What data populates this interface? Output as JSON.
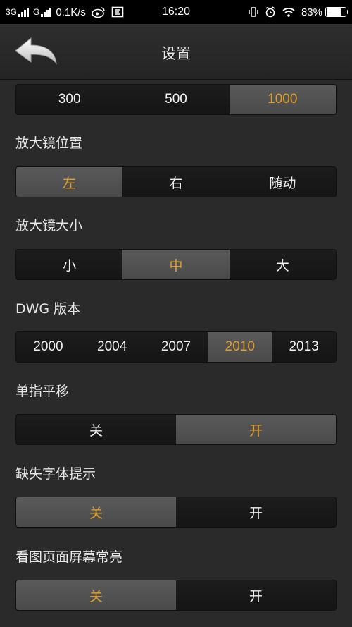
{
  "status_bar": {
    "network1": "3G",
    "network2": "G",
    "speed": "0.1K/s",
    "time": "16:20",
    "battery": "83%",
    "battery_level": 0.83
  },
  "header": {
    "title": "设置"
  },
  "settings": {
    "first_row": {
      "options": [
        "300",
        "500",
        "1000"
      ],
      "selected": 2
    },
    "magnifier_position": {
      "label": "放大镜位置",
      "options": [
        "左",
        "右",
        "随动"
      ],
      "selected": 0
    },
    "magnifier_size": {
      "label": "放大镜大小",
      "options": [
        "小",
        "中",
        "大"
      ],
      "selected": 1
    },
    "dwg_version": {
      "label": "DWG 版本",
      "options": [
        "2000",
        "2004",
        "2007",
        "2010",
        "2013"
      ],
      "selected": 3
    },
    "single_finger_pan": {
      "label": "单指平移",
      "options": [
        "关",
        "开"
      ],
      "selected": 1
    },
    "missing_font_prompt": {
      "label": "缺失字体提示",
      "options": [
        "关",
        "开"
      ],
      "selected": 0
    },
    "screen_always_on": {
      "label": "看图页面屏幕常亮",
      "options": [
        "关",
        "开"
      ],
      "selected": 0
    }
  },
  "colors": {
    "accent": "#e0a030",
    "background": "#2a2a2a"
  }
}
